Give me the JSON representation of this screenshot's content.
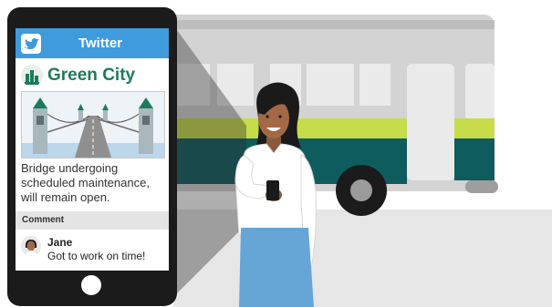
{
  "phone": {
    "app_title": "Twitter",
    "account_name": "Green City",
    "post_text": "Bridge undergoing scheduled maintenance, will remain open.",
    "comment_section_label": "Comment",
    "comment": {
      "author": "Jane",
      "text": "Got to work on time!"
    }
  },
  "icons": {
    "app_logo": "bird-icon",
    "account_avatar": "city-icon",
    "commenter_avatar": "person-avatar-icon",
    "home_button": "home-button"
  },
  "colors": {
    "twitter_blue": "#3f9bdb",
    "brand_green": "#1e7a5c",
    "bus_grey": "#d3d3d3",
    "bus_stripe": "#c7dc4a",
    "bus_body_teal": "#0f5c5e",
    "skirt_blue": "#66a6d6",
    "phone_body": "#1b1b1b"
  }
}
